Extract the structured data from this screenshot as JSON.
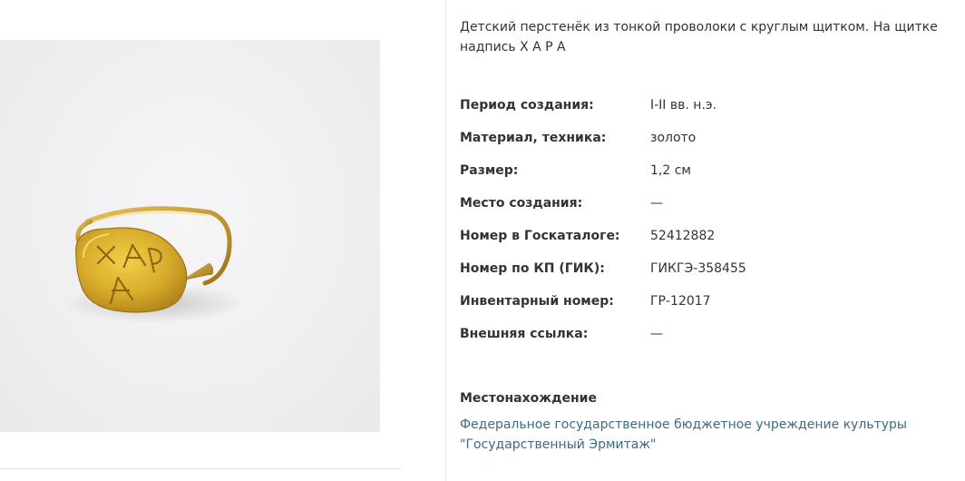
{
  "top_dash": "—",
  "description": "Детский перстенёк из тонкой проволоки с круглым щитком. На щитке надпись Х А Р А",
  "properties": [
    {
      "label": "Период создания:",
      "value": "I-II вв. н.э."
    },
    {
      "label": "Материал, техника:",
      "value": "золото"
    },
    {
      "label": "Размер:",
      "value": "1,2 см"
    },
    {
      "label": "Место создания:",
      "value": "—"
    },
    {
      "label": "Номер в Госкаталоге:",
      "value": "52412882"
    },
    {
      "label": "Номер по КП (ГИК):",
      "value": "ГИКГЭ-358455"
    },
    {
      "label": "Инвентарный номер:",
      "value": "ГР-12017"
    },
    {
      "label": "Внешняя ссылка:",
      "value": "—"
    }
  ],
  "location": {
    "title": "Местонахождение",
    "link_text": "Федеральное государственное бюджетное учреждение культуры \"Государственный Эрмитаж\""
  },
  "colors": {
    "link": "#3d6b87",
    "gold": "#c9a227"
  }
}
